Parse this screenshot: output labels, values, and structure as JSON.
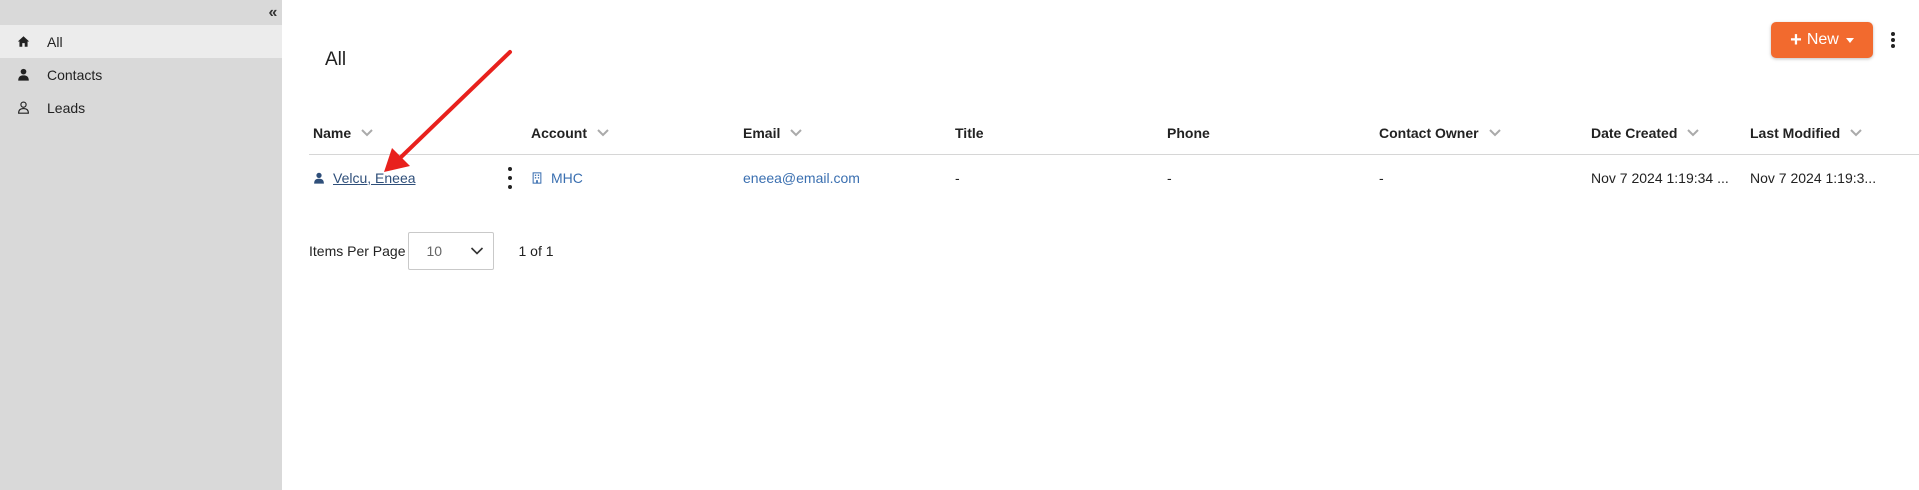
{
  "sidebar": {
    "collapse_glyph": "«",
    "items": [
      {
        "label": "All",
        "icon": "home-icon",
        "active": true
      },
      {
        "label": "Contacts",
        "icon": "person-icon",
        "active": false
      },
      {
        "label": "Leads",
        "icon": "person-outline-icon",
        "active": false
      }
    ]
  },
  "header": {
    "title": "All",
    "new_label": "New"
  },
  "table": {
    "columns": [
      "Name",
      "Account",
      "Email",
      "Title",
      "Phone",
      "Contact Owner",
      "Date Created",
      "Last Modified"
    ],
    "rows": [
      {
        "name": "Velcu, Eneea",
        "account": "MHC",
        "email": "eneea@email.com",
        "title": "-",
        "phone": "-",
        "owner": "-",
        "date_created": "Nov 7 2024 1:19:34 ...",
        "last_modified": "Nov 7 2024 1:19:3..."
      }
    ]
  },
  "pager": {
    "label": "Items Per Page",
    "per_page": "10",
    "count": "1 of 1"
  },
  "colors": {
    "accent": "#f26a2e",
    "link": "#3a6fb0",
    "sidebar_bg": "#d9d9d9",
    "annotation": "#e8211d"
  }
}
